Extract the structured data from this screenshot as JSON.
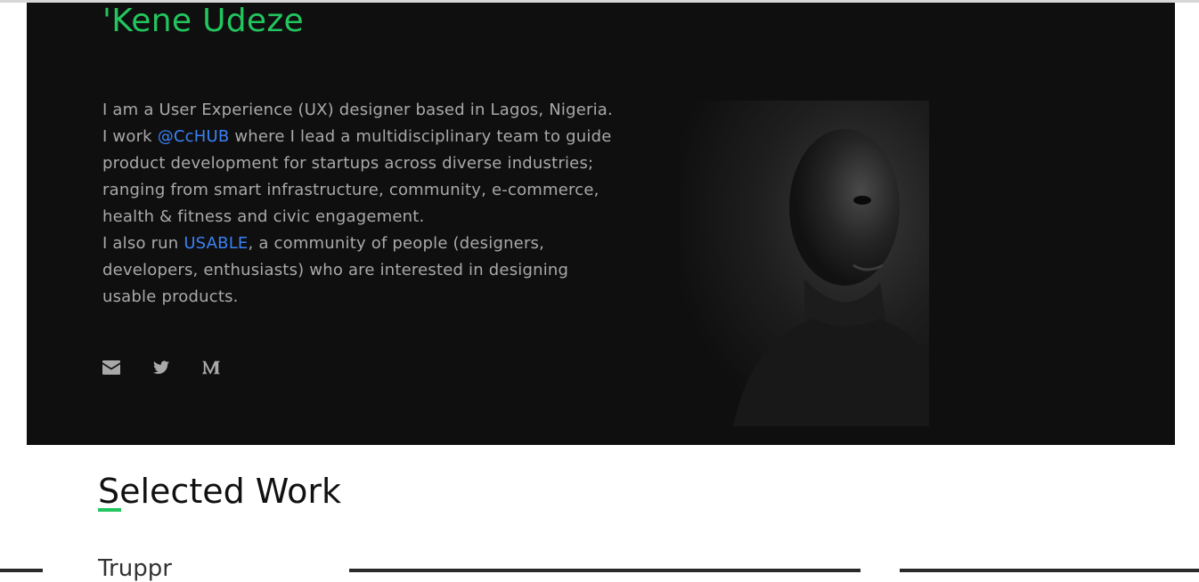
{
  "hero": {
    "name": "'Kene Udeze",
    "bio": {
      "p1_start": "I am a User Experience (UX) designer based in Lagos, Nigeria. I work ",
      "cchub_link": "@CcHUB",
      "p1_end": " where I lead a multidisciplinary team to guide product development for startups across diverse industries; ranging from smart infrastructure, community, e-commerce, health & fitness and civic engagement.",
      "p2_start": "I also run ",
      "usable_link": "USABLE",
      "p2_end": ", a community of people (designers, developers, enthusiasts) who are interested in designing usable products."
    },
    "socials": [
      {
        "icon": "envelope-icon"
      },
      {
        "icon": "twitter-icon"
      },
      {
        "icon": "medium-icon"
      }
    ]
  },
  "selected_work": {
    "title": "Selected Work",
    "first_project": "Truppr"
  },
  "colors": {
    "accent_green": "#22c55e",
    "link_blue": "#3b82f6",
    "hero_bg": "#0f0f0f",
    "bio_text": "#a9a9a9"
  }
}
